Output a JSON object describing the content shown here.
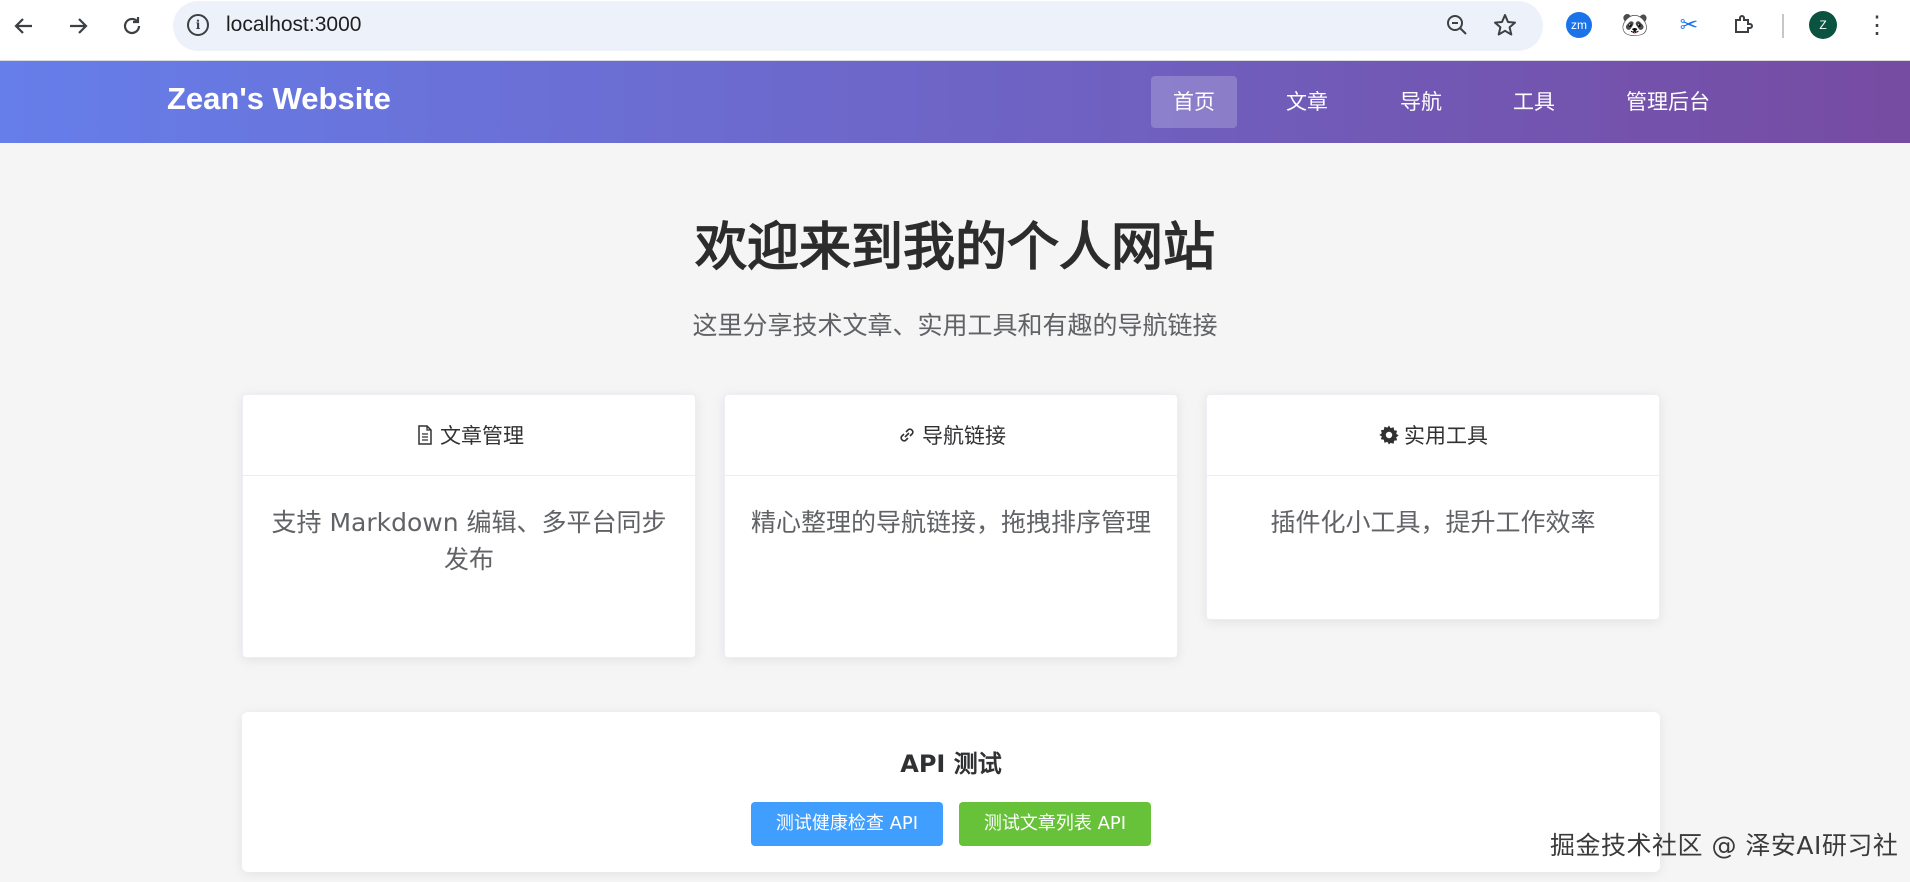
{
  "browser": {
    "url": "localhost:3000",
    "extensions": [
      {
        "name": "zm",
        "label": "zm",
        "color": "#1a73e8"
      },
      {
        "name": "panda",
        "label": "🐼",
        "color": "#ffffff"
      },
      {
        "name": "scissors",
        "label": "✂",
        "color": "#ffffff"
      }
    ],
    "profile_initial": "Z"
  },
  "site": {
    "brand": "Zean's Website",
    "nav": [
      {
        "label": "首页",
        "active": true
      },
      {
        "label": "文章",
        "active": false
      },
      {
        "label": "导航",
        "active": false
      },
      {
        "label": "工具",
        "active": false
      },
      {
        "label": "管理后台",
        "active": false
      }
    ]
  },
  "hero": {
    "title": "欢迎来到我的个人网站",
    "subtitle": "这里分享技术文章、实用工具和有趣的导航链接"
  },
  "cards": [
    {
      "icon": "document-icon",
      "title": "文章管理",
      "body": "支持 Markdown 编辑、多平台同步发布"
    },
    {
      "icon": "link-icon",
      "title": "导航链接",
      "body": "精心整理的导航链接，拖拽排序管理"
    },
    {
      "icon": "gear-icon",
      "title": "实用工具",
      "body": "插件化小工具，提升工作效率"
    }
  ],
  "api": {
    "title": "API 测试",
    "health_button": "测试健康检查 API",
    "articles_button": "测试文章列表 API"
  },
  "watermark": "掘金技术社区 @ 泽安AI研习社"
}
